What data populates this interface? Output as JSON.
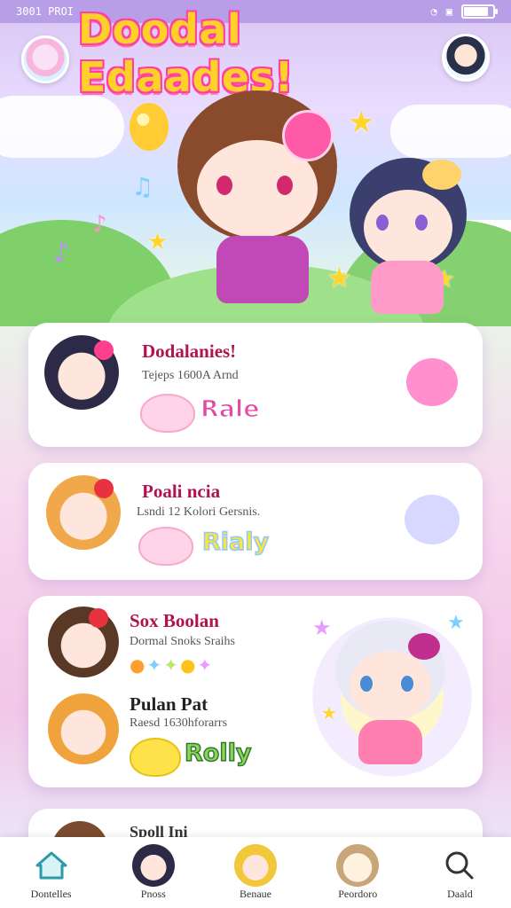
{
  "status_bar": {
    "time": "3001 PROI",
    "battery_level": 0.9
  },
  "header": {
    "title": "Doodal Edaades!"
  },
  "cards": [
    {
      "title": "Dodalanies!",
      "subtitle": "Tejeps 1600A Arnd",
      "action_label": "Rale",
      "action_color": "#e24aa6"
    },
    {
      "title": "Poali ncia",
      "subtitle": "Lsndi 12 Kolori Gersnis.",
      "action_label": "Rialy",
      "action_color": "#ffe23a"
    },
    {
      "title": "Sox Boolan",
      "subtitle": "Dormal Snoks Sraihs"
    },
    {
      "title": "Pulan Pat",
      "subtitle": "Raesd 1630hforarrs",
      "action_label": "Rolly",
      "action_color": "#8fd35a"
    },
    {
      "title": "Spoll Ini"
    }
  ],
  "bottom_nav": [
    {
      "label": "Dontelles",
      "icon": "home-icon"
    },
    {
      "label": "Pnoss",
      "icon": "avatar-icon"
    },
    {
      "label": "Benaue",
      "icon": "avatar-icon"
    },
    {
      "label": "Peordoro",
      "icon": "avatar-icon"
    },
    {
      "label": "Daald",
      "icon": "search-icon"
    }
  ],
  "colors": {
    "accent": "#b0134f",
    "title_fill": "#ffcf2a",
    "title_outline": "#ff3fa4"
  }
}
